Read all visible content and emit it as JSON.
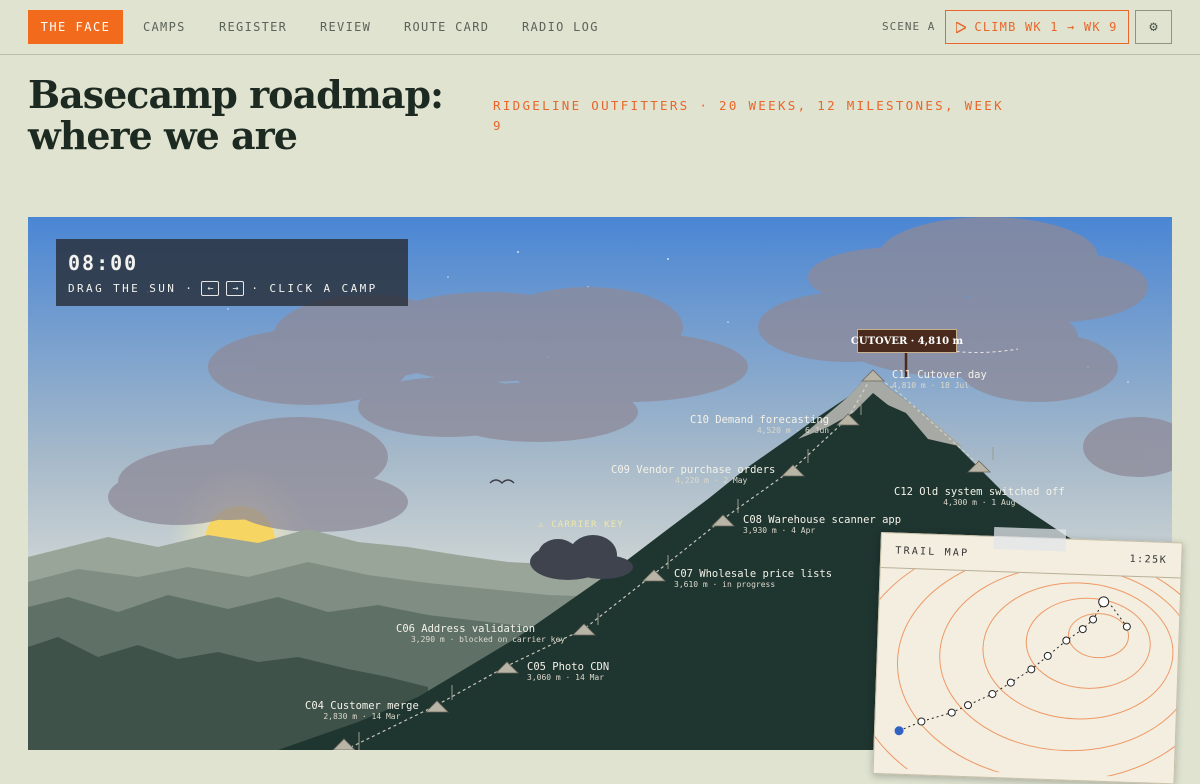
{
  "nav": {
    "brand": "THE FACE",
    "links": [
      "CAMPS",
      "REGISTER",
      "REVIEW",
      "ROUTE CARD",
      "RADIO LOG"
    ],
    "scene_label": "SCENE A",
    "climb_label": "CLIMB WK 1 → WK 9",
    "play_icon": "play-icon",
    "settings_icon": "gear-icon"
  },
  "page": {
    "title_line1": "Basecamp roadmap:",
    "title_line2": "where we are",
    "subtitle": "RIDGELINE OUTFITTERS · 20 WEEKS, 12 MILESTONES, WEEK 9"
  },
  "scene": {
    "clock": "08:00",
    "help_prefix": "DRAG THE SUN ·",
    "help_suffix": "· CLICK A CAMP",
    "key_left": "←",
    "key_right": "→",
    "summit_sign": "CUTOVER · 4,810 m",
    "carrier_key": "⚠ CARRIER KEY",
    "colors": {
      "sky_top": "#4a86d4",
      "sky_bottom": "#eaeef0",
      "mountain": "#1f3530",
      "snow": "#a7a9a5",
      "accent": "#e8672a"
    }
  },
  "camps": [
    {
      "id": "c04",
      "name": "C04 Customer merge",
      "meta": "2,830 m · 14 Mar"
    },
    {
      "id": "c05",
      "name": "C05 Photo CDN",
      "meta": "3,060 m · 14 Mar"
    },
    {
      "id": "c06",
      "name": "C06 Address validation",
      "meta": "3,290 m · blocked on carrier key"
    },
    {
      "id": "c07",
      "name": "C07 Wholesale price lists",
      "meta": "3,610 m · in progress"
    },
    {
      "id": "c08",
      "name": "C08 Warehouse scanner app",
      "meta": "3,930 m · 4 Apr"
    },
    {
      "id": "c09",
      "name": "C09 Vendor purchase orders",
      "meta": "4,220 m · 2 May"
    },
    {
      "id": "c10",
      "name": "C10 Demand forecasting",
      "meta": "4,520 m · 6 Jun"
    },
    {
      "id": "c11",
      "name": "C11 Cutover day",
      "meta": "4,810 m · 18 Jul"
    },
    {
      "id": "c12",
      "name": "C12 Old system switched off",
      "meta": "4,300 m · 1 Aug"
    }
  ],
  "trail_map": {
    "title": "TRAIL MAP",
    "scale": "1:25K"
  }
}
